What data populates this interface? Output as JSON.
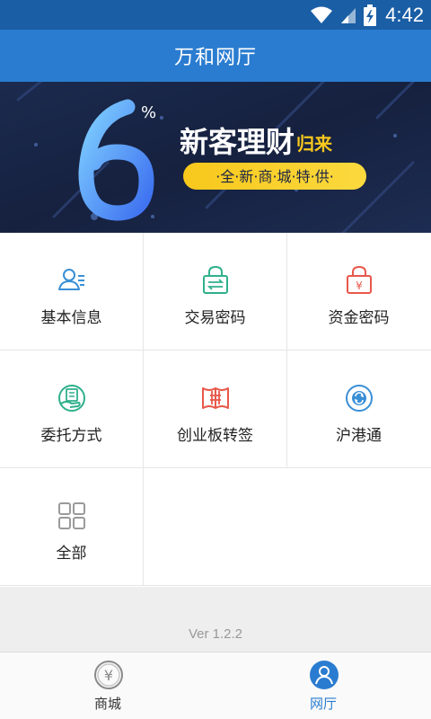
{
  "status_bar": {
    "time": "4:42"
  },
  "header": {
    "title": "万和网厅"
  },
  "banner": {
    "percent": "%",
    "big_digit": "6",
    "headline": "新客理财",
    "headline_suffix": "归来",
    "subline": "·全·新·商·城·特·供·",
    "page_count": 2,
    "active_index": 0
  },
  "grid": {
    "items": [
      {
        "label": "基本信息",
        "icon": "user-info-icon",
        "color": "#3a8fd6"
      },
      {
        "label": "交易密码",
        "icon": "lock-transfer-icon",
        "color": "#2fb08c"
      },
      {
        "label": "资金密码",
        "icon": "lock-yen-icon",
        "color": "#e8584a"
      },
      {
        "label": "委托方式",
        "icon": "hand-doc-icon",
        "color": "#2fb08c"
      },
      {
        "label": "创业板转签",
        "icon": "gem-board-icon",
        "color": "#e8584a"
      },
      {
        "label": "沪港通",
        "icon": "exchange-circle-icon",
        "color": "#3a8fd6"
      },
      {
        "label": "全部",
        "icon": "grid-all-icon",
        "color": "#9a9a9a"
      }
    ]
  },
  "footer": {
    "version": "Ver 1.2.2"
  },
  "bottom_nav": {
    "items": [
      {
        "label": "商城",
        "icon": "yen-coin-icon",
        "active": false
      },
      {
        "label": "网厅",
        "icon": "person-icon",
        "active": true
      }
    ],
    "active_color": "#2a7cd0",
    "inactive_color": "#333333"
  }
}
